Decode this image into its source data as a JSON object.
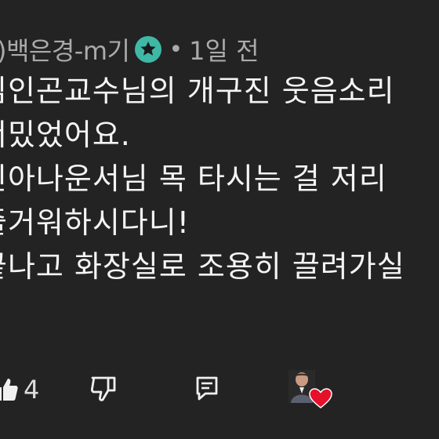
{
  "comment": {
    "author": ")백은경-m기",
    "dot": "•",
    "time": "1일 전",
    "lines": [
      "님인곤교수님의 개구진 웃음소리",
      "너밌었어요.",
      "빈아나운서님 목 타시는 걸 저리",
      "즐거워하시다니!",
      "끝나고 화장실로 조용히 끌려가실"
    ]
  },
  "actions": {
    "like_count": "4"
  },
  "icons": {
    "badge": "verified-star-icon",
    "like": "thumbs-up-icon",
    "dislike": "thumbs-down-icon",
    "reply": "reply-comment-icon",
    "creator_heart": "red-heart-icon"
  },
  "colors": {
    "background": "#232323",
    "text": "#f4f4f4",
    "muted": "#aaaaaa",
    "badge": "#3fb8a6",
    "heart": "#e5102a"
  }
}
